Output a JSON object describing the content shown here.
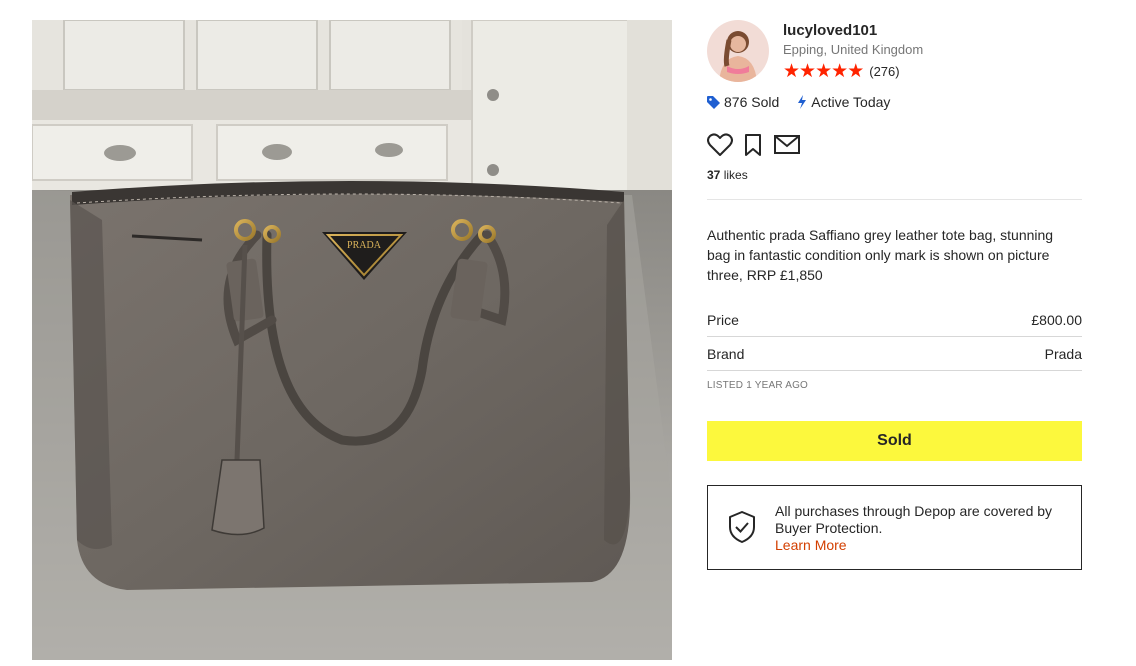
{
  "seller": {
    "username": "lucyloved101",
    "location": "Epping, United Kingdom",
    "stars": 5,
    "rating_count": "(276)",
    "sold_count": "876 Sold",
    "activity": "Active Today"
  },
  "engagement": {
    "likes_count": "37",
    "likes_label": "likes"
  },
  "product": {
    "description": "Authentic prada Saffiano grey leather tote bag, stunning bag in fantastic condition only mark is shown on picture three, RRP £1,850",
    "attributes": [
      {
        "label": "Price",
        "value": "£800.00"
      },
      {
        "label": "Brand",
        "value": "Prada"
      }
    ],
    "listed": "LISTED 1 YEAR AGO",
    "status_button": "Sold",
    "logo_text": "PRADA"
  },
  "protection": {
    "text": "All purchases through Depop are covered by Buyer Protection.",
    "link": "Learn More"
  },
  "icons": {
    "heart": "heart-icon",
    "bookmark": "bookmark-icon",
    "message": "envelope-icon",
    "sold_tag": "tag-icon",
    "active": "lightning-icon",
    "shield": "shield-check-icon"
  },
  "colors": {
    "star": "#ff2300",
    "sold_button": "#fcf83d",
    "link": "#d33f00",
    "tag_icon": "#1f5fd1"
  }
}
